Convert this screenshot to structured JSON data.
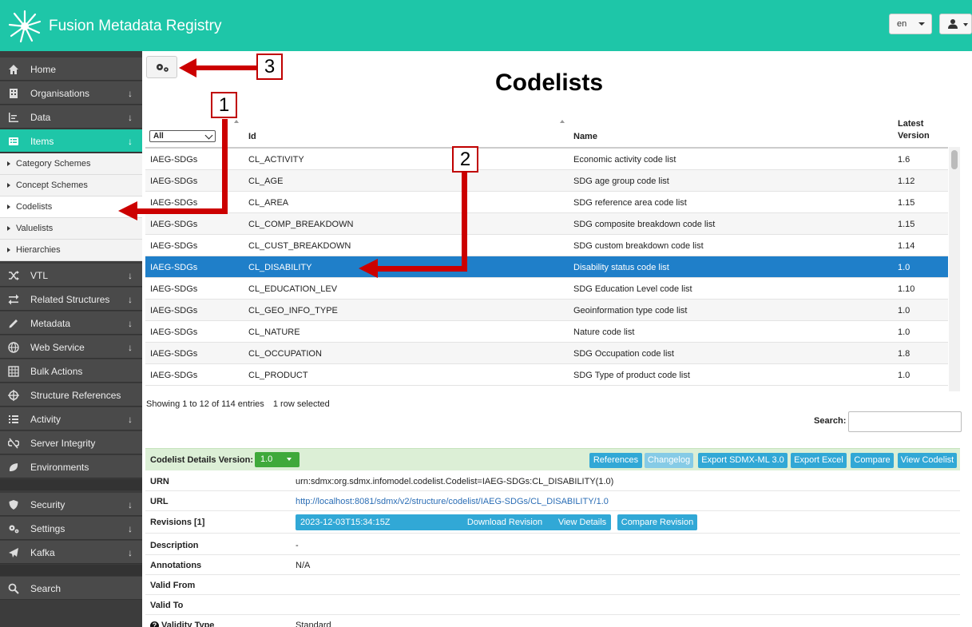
{
  "app": {
    "title": "Fusion Metadata Registry",
    "lang": "en"
  },
  "sidebar": {
    "items": [
      {
        "label": "Home"
      },
      {
        "label": "Organisations"
      },
      {
        "label": "Data"
      },
      {
        "label": "Items"
      },
      {
        "label": "VTL"
      },
      {
        "label": "Related Structures"
      },
      {
        "label": "Metadata"
      },
      {
        "label": "Web Service"
      },
      {
        "label": "Bulk Actions"
      },
      {
        "label": "Structure References"
      },
      {
        "label": "Activity"
      },
      {
        "label": "Server Integrity"
      },
      {
        "label": "Environments"
      },
      {
        "label": "Security"
      },
      {
        "label": "Settings"
      },
      {
        "label": "Kafka"
      },
      {
        "label": "Search"
      }
    ],
    "subitems": [
      {
        "label": "Category Schemes"
      },
      {
        "label": "Concept Schemes"
      },
      {
        "label": "Codelists"
      },
      {
        "label": "Valuelists"
      },
      {
        "label": "Hierarchies"
      }
    ]
  },
  "page": {
    "title": "Codelists"
  },
  "table": {
    "filter": "All",
    "headers": {
      "id": "Id",
      "name": "Name",
      "version_line1": "Latest",
      "version_line2": "Version"
    },
    "rows": [
      {
        "agency": "IAEG-SDGs",
        "id": "CL_ACTIVITY",
        "name": "Economic activity code list",
        "version": "1.6"
      },
      {
        "agency": "IAEG-SDGs",
        "id": "CL_AGE",
        "name": "SDG age group code list",
        "version": "1.12"
      },
      {
        "agency": "IAEG-SDGs",
        "id": "CL_AREA",
        "name": "SDG reference area code list",
        "version": "1.15"
      },
      {
        "agency": "IAEG-SDGs",
        "id": "CL_COMP_BREAKDOWN",
        "name": "SDG composite breakdown code list",
        "version": "1.15"
      },
      {
        "agency": "IAEG-SDGs",
        "id": "CL_CUST_BREAKDOWN",
        "name": "SDG custom breakdown code list",
        "version": "1.14"
      },
      {
        "agency": "IAEG-SDGs",
        "id": "CL_DISABILITY",
        "name": "Disability status code list",
        "version": "1.0"
      },
      {
        "agency": "IAEG-SDGs",
        "id": "CL_EDUCATION_LEV",
        "name": "SDG Education Level code list",
        "version": "1.10"
      },
      {
        "agency": "IAEG-SDGs",
        "id": "CL_GEO_INFO_TYPE",
        "name": "Geoinformation type code list",
        "version": "1.0"
      },
      {
        "agency": "IAEG-SDGs",
        "id": "CL_NATURE",
        "name": "Nature code list",
        "version": "1.0"
      },
      {
        "agency": "IAEG-SDGs",
        "id": "CL_OCCUPATION",
        "name": "SDG Occupation code list",
        "version": "1.8"
      },
      {
        "agency": "IAEG-SDGs",
        "id": "CL_PRODUCT",
        "name": "SDG Type of product code list",
        "version": "1.0"
      }
    ],
    "info": "Showing 1 to 12 of 114 entries",
    "selected_info": "1 row selected",
    "search_label": "Search:"
  },
  "details": {
    "label": "Codelist Details Version:",
    "version": "1.0",
    "buttons": [
      "References",
      "Changelog",
      "Export SDMX-ML 3.0",
      "Export Excel",
      "Compare",
      "View Codelist"
    ],
    "rows": [
      {
        "key": "URN",
        "value": "urn:sdmx:org.sdmx.infomodel.codelist.Codelist=IAEG-SDGs:CL_DISABILITY(1.0)"
      },
      {
        "key": "URL",
        "value": "http://localhost:8081/sdmx/v2/structure/codelist/IAEG-SDGs/CL_DISABILITY/1.0"
      },
      {
        "key": "Revisions [1]",
        "value": "2023-12-03T15:34:15Z"
      },
      {
        "key": "Description",
        "value": "-"
      },
      {
        "key": "Annotations",
        "value": "N/A"
      },
      {
        "key": "Valid From",
        "value": ""
      },
      {
        "key": "Valid To",
        "value": ""
      },
      {
        "key": "Validity Type",
        "value": "Standard"
      }
    ],
    "revision_buttons": [
      "Download Revision",
      "View Details",
      "Compare Revision"
    ]
  },
  "annotations": {
    "callout1": "1",
    "callout2": "2",
    "callout3": "3",
    "arrow_color": "#cc0000"
  },
  "colors": {
    "teal": "#1ec6a8",
    "selected_row": "#1f7fc9",
    "button_blue": "#31a8d6",
    "version_green": "#3fa93b"
  }
}
